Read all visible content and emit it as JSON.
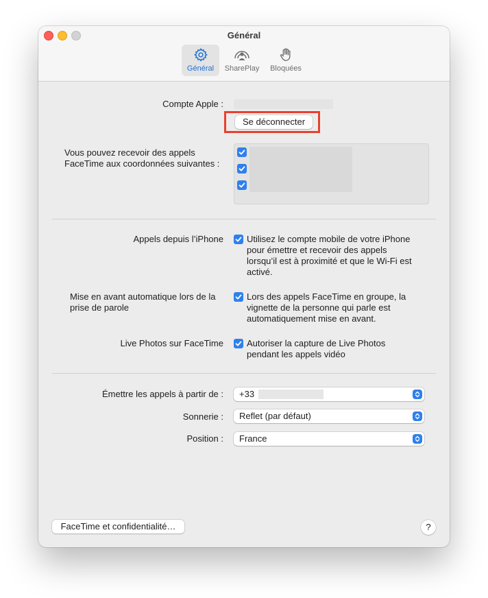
{
  "window": {
    "title": "Général"
  },
  "toolbar": {
    "tabs": [
      {
        "label": "Général",
        "icon": "gear-icon",
        "active": true
      },
      {
        "label": "SharePlay",
        "icon": "shareplay-icon",
        "active": false
      },
      {
        "label": "Bloquées",
        "icon": "hand-icon",
        "active": false
      }
    ]
  },
  "account": {
    "label": "Compte Apple :",
    "sign_out_button": "Se déconnecter"
  },
  "facetime_addresses": {
    "label_line1": "Vous pouvez recevoir des appels",
    "label_line2": "FaceTime aux coordonnées suivantes :",
    "checked_count": 3
  },
  "iphone_calls": {
    "label": "Appels depuis l’iPhone",
    "checked": true,
    "desc_lines": [
      "Utilisez le compte mobile de votre iPhone",
      "pour émettre et recevoir des appels",
      "lorsqu’il est à proximité et que le Wi-Fi est",
      "activé."
    ]
  },
  "speaker_prominence": {
    "label_line1": "Mise en avant automatique lors de la",
    "label_line2": "prise de parole",
    "checked": true,
    "desc_lines": [
      "Lors des appels FaceTime en groupe, la",
      "vignette de la personne qui parle est",
      "automatiquement mise en avant."
    ]
  },
  "live_photos": {
    "label": "Live Photos sur FaceTime",
    "checked": true,
    "desc_lines": [
      "Autoriser la capture de Live Photos",
      "pendant les appels vidéo"
    ]
  },
  "call_from": {
    "label": "Émettre les appels à partir de :",
    "value": "+33"
  },
  "ringtone": {
    "label": "Sonnerie :",
    "value": "Reflet (par défaut)"
  },
  "location": {
    "label": "Position :",
    "value": "France"
  },
  "footer": {
    "privacy_button": "FaceTime et confidentialité…",
    "help_button": "?"
  },
  "colors": {
    "accent": "#2f80ed",
    "active_tab_label": "#1f6fd8",
    "highlight_border": "#e8412d",
    "window_bg": "#ececec"
  }
}
